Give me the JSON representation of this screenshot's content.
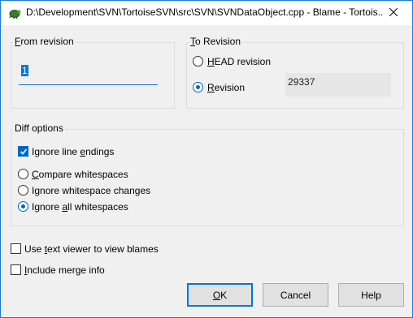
{
  "window": {
    "title": "D:\\Development\\SVN\\TortoiseSVN\\src\\SVN\\SVNDataObject.cpp - Blame - Tortois...",
    "icon": "tortoise-icon",
    "close_icon": "close-icon"
  },
  "from_revision": {
    "group_label": "From revision",
    "accel": "F",
    "label_rest": "rom revision",
    "value": "1"
  },
  "to_revision": {
    "group_label": "To Revision",
    "accel": "T",
    "label_rest": "o Revision",
    "head_label": {
      "accel": "H",
      "rest": "EAD revision"
    },
    "revision_label": {
      "accel": "R",
      "rest": "evision"
    },
    "selected": "revision",
    "revision_value": "29337"
  },
  "diff_options": {
    "group_label": "Diff options",
    "ignore_line_endings": {
      "pre": "Ignore line ",
      "accel": "e",
      "post": "ndings",
      "checked": true
    },
    "compare_whitespaces": {
      "accel": "C",
      "rest": "ompare whitespaces",
      "checked": false
    },
    "ignore_whitespace_changes": {
      "pre": "I",
      "accel": "g",
      "post": "nore whitespace changes",
      "checked": false
    },
    "ignore_all_whitespaces": {
      "pre": "Ignore ",
      "accel": "a",
      "post": "ll whitespaces",
      "checked": true
    }
  },
  "use_text_viewer": {
    "pre": "Use ",
    "accel": "t",
    "post": "ext viewer to view blames",
    "checked": false
  },
  "include_merge_info": {
    "accel": "I",
    "rest": "nclude merge info",
    "checked": false
  },
  "buttons": {
    "ok": {
      "accel": "O",
      "rest": "K"
    },
    "cancel": "Cancel",
    "help": "Help"
  },
  "colors": {
    "accent": "#0067c0",
    "window_bg": "#f0f0f0",
    "border": "#1e78d7"
  }
}
